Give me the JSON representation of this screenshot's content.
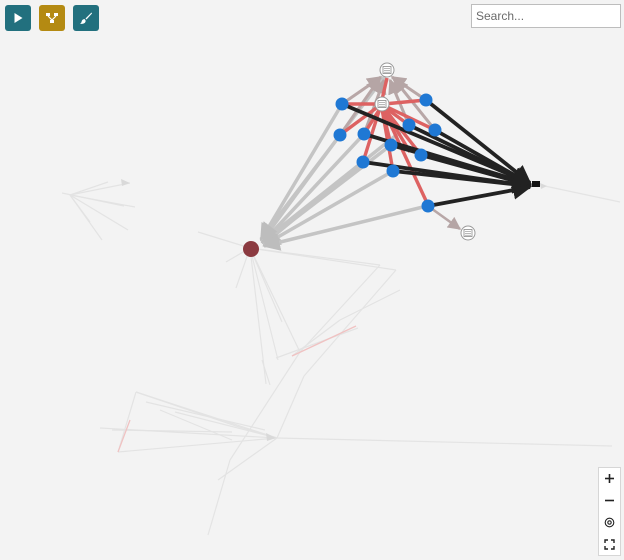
{
  "toolbar": {
    "play": {
      "icon": "play-icon",
      "color": "#22707e"
    },
    "layout": {
      "icon": "network-icon",
      "color": "#b48a12"
    },
    "style": {
      "icon": "brush-icon",
      "color": "#22707e"
    }
  },
  "search": {
    "placeholder": "Search...",
    "value": ""
  },
  "zoom_controls": [
    {
      "name": "zoom-in-button",
      "icon": "plus-icon"
    },
    {
      "name": "zoom-out-button",
      "icon": "minus-icon"
    },
    {
      "name": "zoom-reset-button",
      "icon": "target-icon"
    },
    {
      "name": "fullscreen-button",
      "icon": "fullscreen-icon"
    }
  ],
  "graph": {
    "node_colors": {
      "source": "#1f78d4",
      "target": "#8b3a40",
      "document": "#bfbfbf"
    },
    "edge_colors": {
      "highlight": "#dd6060",
      "dark": "#222222",
      "muted": "#bdbdbd",
      "faded": "#dcdcdc"
    },
    "source_node_count": 12,
    "target_node_count": 1,
    "document_node_count": 3
  }
}
